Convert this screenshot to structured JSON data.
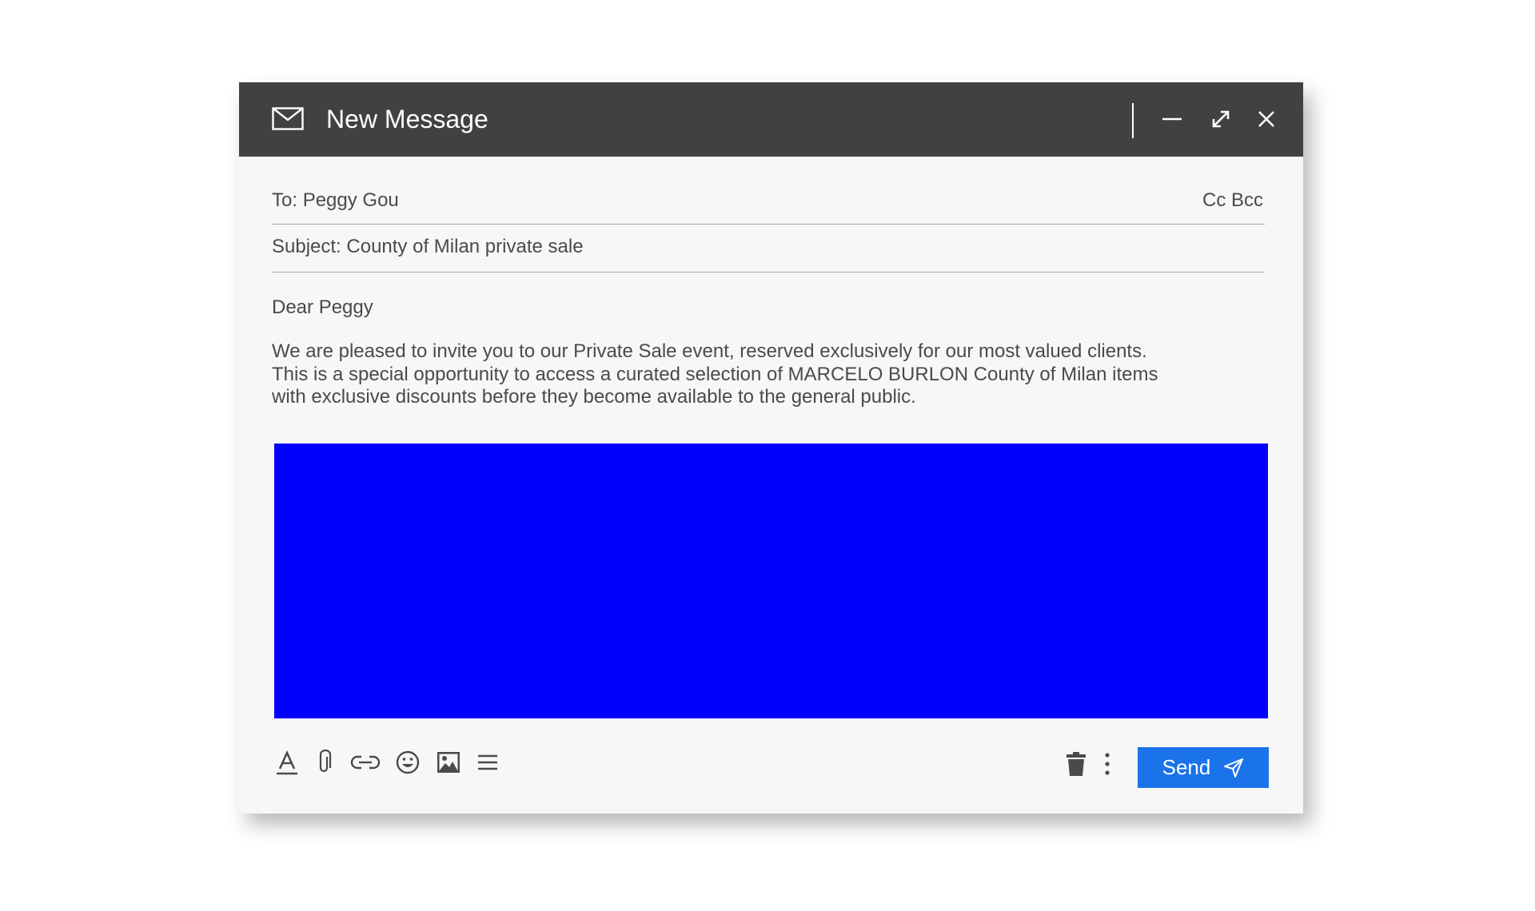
{
  "window": {
    "title": "New Message",
    "title_bar_color": "#414141",
    "background_color": "#f7f7f7",
    "icons": [
      "mail-icon",
      "minimize-icon",
      "maximize-icon",
      "close-icon"
    ]
  },
  "to": {
    "label": "To:",
    "value": "Peggy Gou",
    "cc_bcc_label": "Cc Bcc"
  },
  "subject": {
    "label": "Subject:",
    "value": "County of Milan private sale"
  },
  "message": {
    "greeting": "Dear Peggy",
    "body": "We are pleased to invite you to our Private Sale event, reserved exclusively for our most valued clients.\nThis is a special opportunity to access a curated selection of MARCELO BURLON County of Milan items\nwith exclusive discounts before they become available to the general public.",
    "banner_color": "#0000ff"
  },
  "toolbar": {
    "icons": [
      "text-format-icon",
      "attachment-icon",
      "link-icon",
      "emoji-icon",
      "image-icon",
      "list-icon",
      "trash-icon",
      "more-options-icon"
    ],
    "send_label": "Send",
    "send_color": "#1a73e8"
  }
}
